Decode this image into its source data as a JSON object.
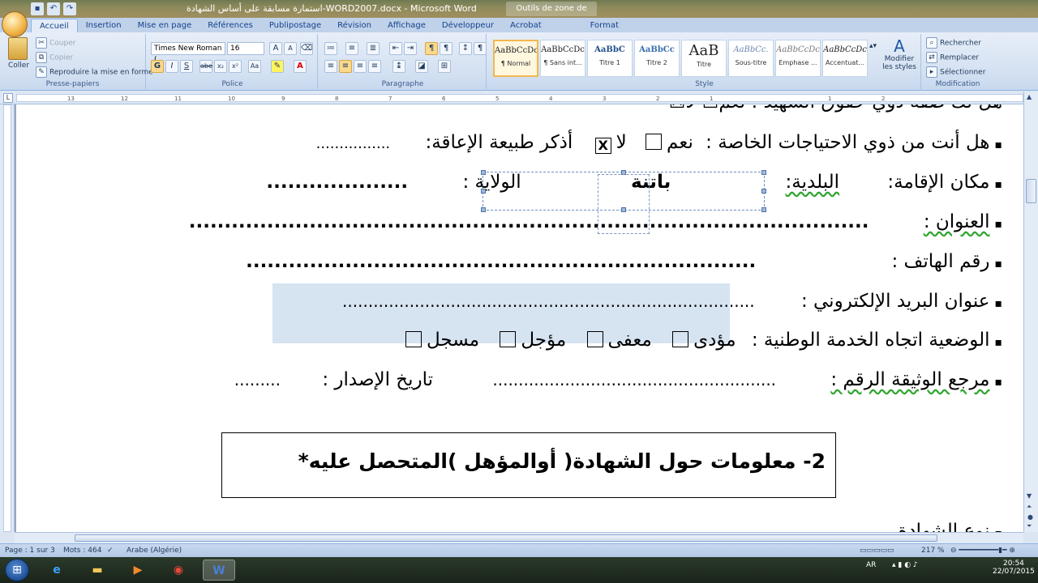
{
  "window": {
    "title": "استمارة مسابقة على أساس الشهادة-WORD2007.docx - Microsoft Word",
    "context_tab_group": "Outils de zone de texte"
  },
  "quick_access": {
    "save_icon": "save-icon",
    "undo_icon": "undo-icon",
    "redo_icon": "redo-icon"
  },
  "tabs": [
    "Accueil",
    "Insertion",
    "Mise en page",
    "Références",
    "Publipostage",
    "Révision",
    "Affichage",
    "Développeur",
    "Acrobat"
  ],
  "context_tab": "Format",
  "clipboard": {
    "paste": "Coller",
    "cut": "Couper",
    "copy": "Copier",
    "format_painter": "Reproduire la mise en forme",
    "label": "Presse-papiers"
  },
  "font": {
    "name": "Times New Roman (",
    "size": "16",
    "label": "Police",
    "bold": "G",
    "italic": "I",
    "underline": "S",
    "strike": "abe",
    "subscript": "x₂",
    "superscript": "x²",
    "case": "Aa",
    "grow": "A",
    "shrink": "A"
  },
  "paragraph": {
    "label": "Paragraphe"
  },
  "styles": {
    "label": "Style",
    "tiles": [
      {
        "sample": "AaBbCcDc",
        "name": "¶ Normal"
      },
      {
        "sample": "AaBbCcDc",
        "name": "¶ Sans int..."
      },
      {
        "sample": "AaBbC",
        "name": "Titre 1"
      },
      {
        "sample": "AaBbCc",
        "name": "Titre 2"
      },
      {
        "sample": "AaB",
        "name": "Titre"
      },
      {
        "sample": "AaBbCc.",
        "name": "Sous-titre"
      },
      {
        "sample": "AaBbCcDc",
        "name": "Emphase ..."
      },
      {
        "sample": "AaBbCcDc",
        "name": "Accentuat..."
      }
    ],
    "change_styles": "Modifier les styles"
  },
  "editing": {
    "label": "Modification",
    "find": "Rechercher",
    "replace": "Remplacer",
    "select": "Sélectionner"
  },
  "ruler": {
    "ticks": [
      "13",
      "12",
      "11",
      "10",
      "9",
      "8",
      "7",
      "6",
      "5",
      "4",
      "3",
      "2",
      "1",
      "1",
      "2"
    ]
  },
  "document": {
    "top_cut_line": "هل لك صفة ذوي حقوق الشهيد :  نعم☐   لا☒",
    "special_needs": {
      "question": "هل أنت من ذوي الاحتياجات الخاصة :",
      "yes": "نعم",
      "no": "لا",
      "no_mark": "X",
      "disability": "أذكر طبيعة الإعاقة:",
      "dots": "................"
    },
    "residence": {
      "label": "مكان الإقامة:",
      "municipality": "البلدية:",
      "municipality_value": "باتنة",
      "province": "الولاية :",
      "dots": "...................."
    },
    "address": {
      "label": "العنوان :",
      "dots": "................................................................................................"
    },
    "phone": {
      "label": "رقم الهاتف :",
      "dots": "........................................................................"
    },
    "email": {
      "label": "عنوان البريد الإلكتروني :",
      "dots": "................................................................................"
    },
    "military": {
      "label": "الوضعية اتجاه الخدمة الوطنية :",
      "options": [
        "مؤدى",
        "معفى",
        "مؤجل",
        "مسجل"
      ]
    },
    "reference": {
      "label": "مرجع الوثيقة الرقم :",
      "dots": ".......................................................",
      "issue_date": "تاريخ الإصدار :",
      "date_dots": "........."
    },
    "section2_title": "2- معلومات حول الشهادة( أوالمؤهل )المتحصل عليه*",
    "next_line": "نوع الشهادة"
  },
  "status": {
    "page": "Page : 1 sur 3",
    "words": "Mots : 464",
    "language": "Arabe (Algérie)",
    "zoom": "217 %"
  },
  "taskbar": {
    "lang": "AR",
    "time": "20:54",
    "date": "22/07/2015"
  }
}
